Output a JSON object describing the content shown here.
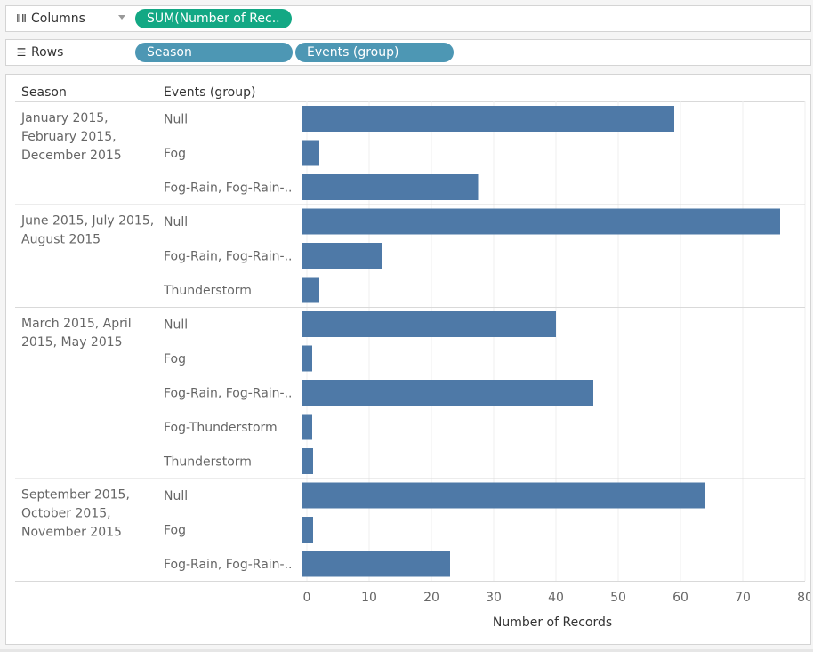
{
  "shelves": {
    "columns": {
      "label": "Columns",
      "icon": "column-bars-icon",
      "pills": [
        "SUM(Number of Rec.."
      ]
    },
    "rows": {
      "label": "Rows",
      "icon": "row-list-icon",
      "pills": [
        "Season",
        "Events (group)"
      ]
    }
  },
  "colors": {
    "bar": "#4e79a7",
    "green_pill": "#13a884",
    "blue_pill": "#4d97b4"
  },
  "chart_data": {
    "type": "bar",
    "orientation": "horizontal",
    "row_headers": [
      "Season",
      "Events (group)"
    ],
    "xlabel": "Number of Records",
    "xlim": [
      -1,
      80
    ],
    "x_ticks": [
      0,
      10,
      20,
      30,
      40,
      50,
      60,
      70,
      80
    ],
    "grid": true,
    "groups": [
      {
        "season_lines": [
          "January 2015,",
          "February 2015,",
          "December 2015"
        ],
        "rows": [
          {
            "event": "Null",
            "value": 59
          },
          {
            "event": "Fog",
            "value": 2
          },
          {
            "event": "Fog-Rain, Fog-Rain-..",
            "value": 27.5
          }
        ]
      },
      {
        "season_lines": [
          "June 2015, July 2015,",
          "August 2015"
        ],
        "rows": [
          {
            "event": "Null",
            "value": 76
          },
          {
            "event": "Fog-Rain, Fog-Rain-..",
            "value": 12
          },
          {
            "event": "Thunderstorm",
            "value": 2
          }
        ]
      },
      {
        "season_lines": [
          "March 2015, April",
          "2015, May 2015"
        ],
        "rows": [
          {
            "event": "Null",
            "value": 40
          },
          {
            "event": "Fog",
            "value": 0
          },
          {
            "event": "Fog-Rain, Fog-Rain-..",
            "value": 46
          },
          {
            "event": "Fog-Thunderstorm",
            "value": 0
          },
          {
            "event": "Thunderstorm",
            "value": 1
          }
        ]
      },
      {
        "season_lines": [
          "September 2015,",
          "October 2015,",
          "November 2015"
        ],
        "rows": [
          {
            "event": "Null",
            "value": 64
          },
          {
            "event": "Fog",
            "value": 1
          },
          {
            "event": "Fog-Rain, Fog-Rain-..",
            "value": 23
          }
        ]
      }
    ]
  }
}
